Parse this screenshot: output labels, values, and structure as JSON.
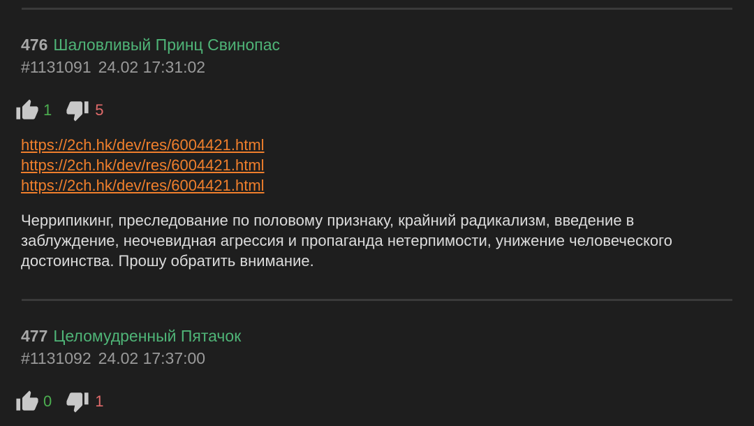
{
  "posts": [
    {
      "number": "476",
      "name": "Шаловливый Принц Свинопас",
      "id": "#1131091",
      "date": "24.02 17:31:02",
      "likes": "1",
      "dislikes": "5",
      "links": [
        "https://2ch.hk/dev/res/6004421.html",
        "https://2ch.hk/dev/res/6004421.html",
        "https://2ch.hk/dev/res/6004421.html"
      ],
      "text": "Черрипикинг, преследование по половому признаку, крайний радикализм, введение в заблуждение, неочевидная агрессия и пропаганда нетерпимости, унижение человеческого достоинства. Прошу обратить внимание."
    },
    {
      "number": "477",
      "name": "Целомудренный Пятачок",
      "id": "#1131092",
      "date": "24.02 17:37:00",
      "likes": "0",
      "dislikes": "1"
    }
  ],
  "colors": {
    "background": "#1e1e1e",
    "name": "#4fb477",
    "link": "#f07f2c",
    "likes": "#4caf50",
    "dislikes": "#e26b6b",
    "icon": "#c8c8c8"
  },
  "icons": {
    "like": "thumbs-up-icon",
    "dislike": "thumbs-down-icon"
  }
}
